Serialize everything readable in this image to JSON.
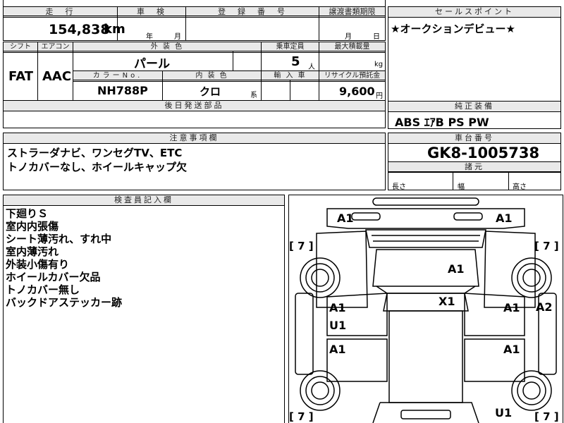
{
  "top": {
    "headers": {
      "mileage": "走　行",
      "inspection": "車　検",
      "registration": "登　録　番　号",
      "transfer_deadline": "譲渡書類期限",
      "sales_point": "セールスポイント"
    },
    "mileage_value": "154,838",
    "mileage_unit": "km",
    "inspection_year": "年",
    "inspection_month": "月",
    "transfer_month": "月",
    "transfer_day": "日",
    "sales_point_text": "★オークションデビュー★"
  },
  "spec": {
    "labels": {
      "shift": "シフト",
      "ac": "エアコン",
      "exterior_color": "外 装 色",
      "capacity": "乗車定員",
      "max_load": "最大積載量",
      "color_no": "カラーNo.",
      "interior_color": "内 装 色",
      "import": "輸 入 車",
      "recycle": "リサイクル預託金"
    },
    "shift": "FAT",
    "ac": "AAC",
    "exterior_color": "パール",
    "capacity": "5",
    "capacity_unit": "人",
    "max_load_unit": "kg",
    "color_no": "NH788P",
    "interior_color": "クロ",
    "interior_suffix": "系",
    "recycle": "9,600",
    "recycle_unit": "円"
  },
  "later_parts": {
    "header": "後日発送部品"
  },
  "genuine_equipment": {
    "header": "純正装備",
    "value": "ABS ｴｱB PS PW"
  },
  "notes": {
    "header": "注意事項欄",
    "lines": [
      "ストラーダナビ、ワンセグTV、ETC",
      "トノカバーなし、ホイールキャップ欠"
    ]
  },
  "chassis": {
    "header": "車台番号",
    "value": "GK8-1005738"
  },
  "dimensions": {
    "header": "諸元",
    "length": "長さ",
    "width": "幅",
    "height": "高さ"
  },
  "inspector": {
    "header": "検査員記入欄",
    "lines": [
      "下廻りＳ",
      "室内内張傷",
      "シート薄汚れ、すれ中",
      "室内薄汚れ",
      "外装小傷有り",
      "ホイールカバー欠品",
      "トノカバー無し",
      "バックドアステッカー跡"
    ]
  },
  "diagram": {
    "marks": {
      "front_left_corner": "A1",
      "front_right_corner": "A1",
      "bracket_tl": "[ 7 ]",
      "bracket_tr": "[ 7 ]",
      "bonnet": "A1",
      "roof": "X1",
      "left_front_door_a": "A1",
      "left_front_door_u": "U1",
      "right_front_door": "A1",
      "right_side": "A2",
      "left_rear_door": "A1",
      "right_rear_door": "A1",
      "bracket_bl": "[ 7 ]",
      "bracket_br": "[ 7 ]",
      "rear_right": "U1"
    }
  }
}
